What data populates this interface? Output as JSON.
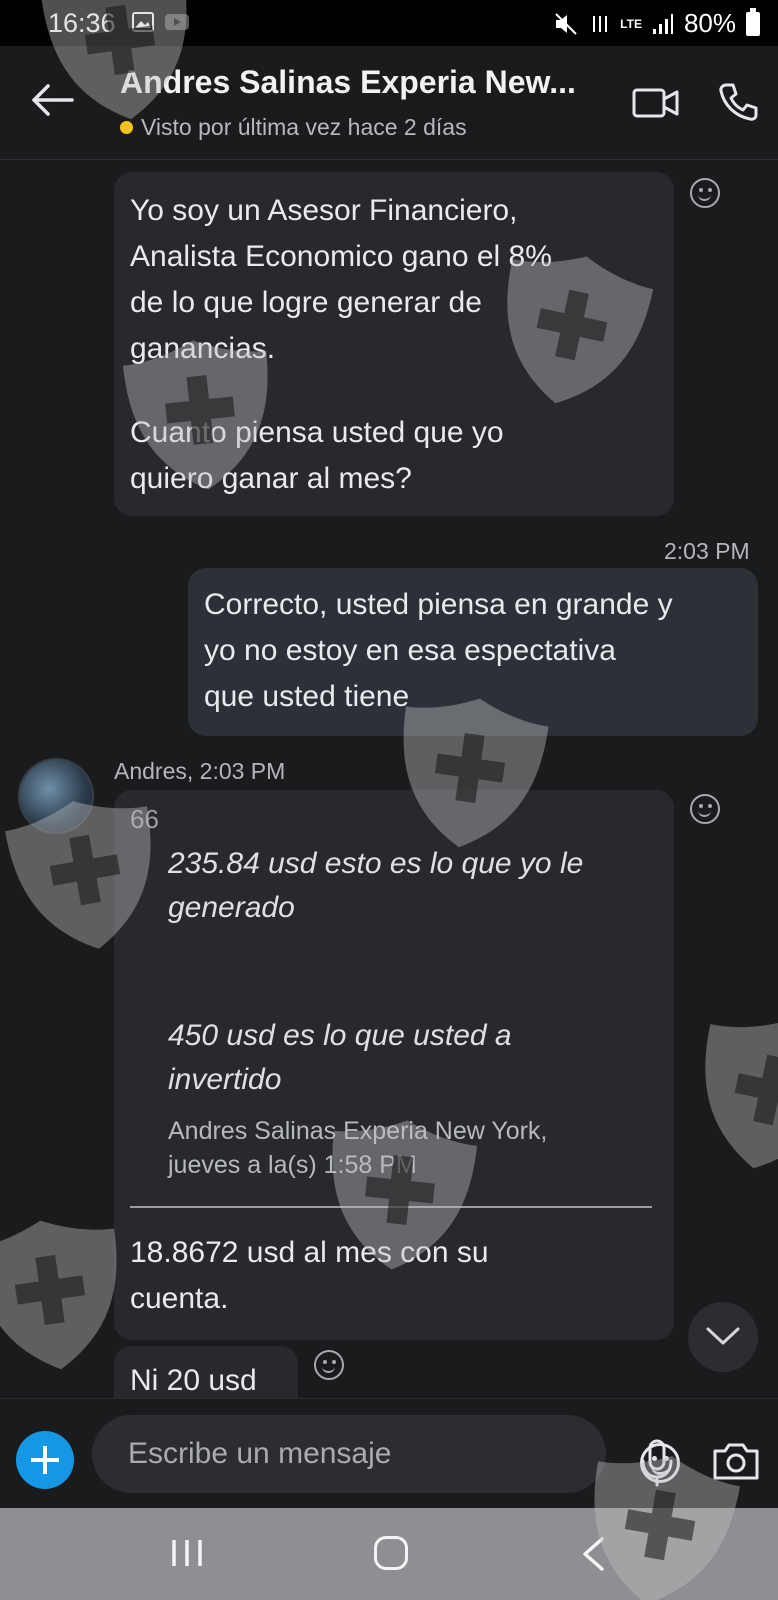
{
  "status_bar": {
    "time": "16:36",
    "network": "LTE",
    "battery": "80%"
  },
  "header": {
    "contact_name": "Andres Salinas Experia New...",
    "last_seen": "Visto por última vez hace 2 días"
  },
  "messages": {
    "m1": {
      "para1": [
        "Yo soy un Asesor Financiero,",
        "Analista Economico gano el 8%",
        "de lo que logre generar de",
        "ganancias."
      ],
      "para2": [
        "Cuanto piensa usted que yo",
        "quiero ganar al mes?"
      ]
    },
    "m2": {
      "time": "2:03 PM",
      "lines": [
        "Correcto, usted piensa en grande y",
        "yo no estoy en esa espectativa",
        "que usted tiene"
      ]
    },
    "m3": {
      "sender_time": "Andres, 2:03 PM",
      "quote_mark": "66",
      "quote_line1": [
        "235.84 usd esto es lo que yo le",
        "generado"
      ],
      "quote_line2": [
        "450 usd es lo que usted a",
        "invertido"
      ],
      "quote_meta": [
        "Andres Salinas Experia New York,",
        "jueves a la(s) 1:58 PM"
      ],
      "reply": [
        "18.8672 usd al mes con su",
        "cuenta."
      ]
    },
    "m4": {
      "text": "Ni 20 usd"
    }
  },
  "composer": {
    "placeholder": "Escribe un mensaje"
  },
  "colors": {
    "background": "#1a1b1d",
    "incoming_bubble": "#27292d",
    "outgoing_bubble": "#2c3138",
    "accent": "#1597e5",
    "presence_dot": "#f0c419"
  },
  "icons": [
    "back-arrow-icon",
    "video-call-icon",
    "phone-call-icon",
    "reaction-icon",
    "chevron-down-icon",
    "plus-icon",
    "emoji-icon",
    "microphone-icon",
    "camera-icon",
    "nav-recent-icon",
    "nav-home-icon",
    "nav-back-icon"
  ]
}
